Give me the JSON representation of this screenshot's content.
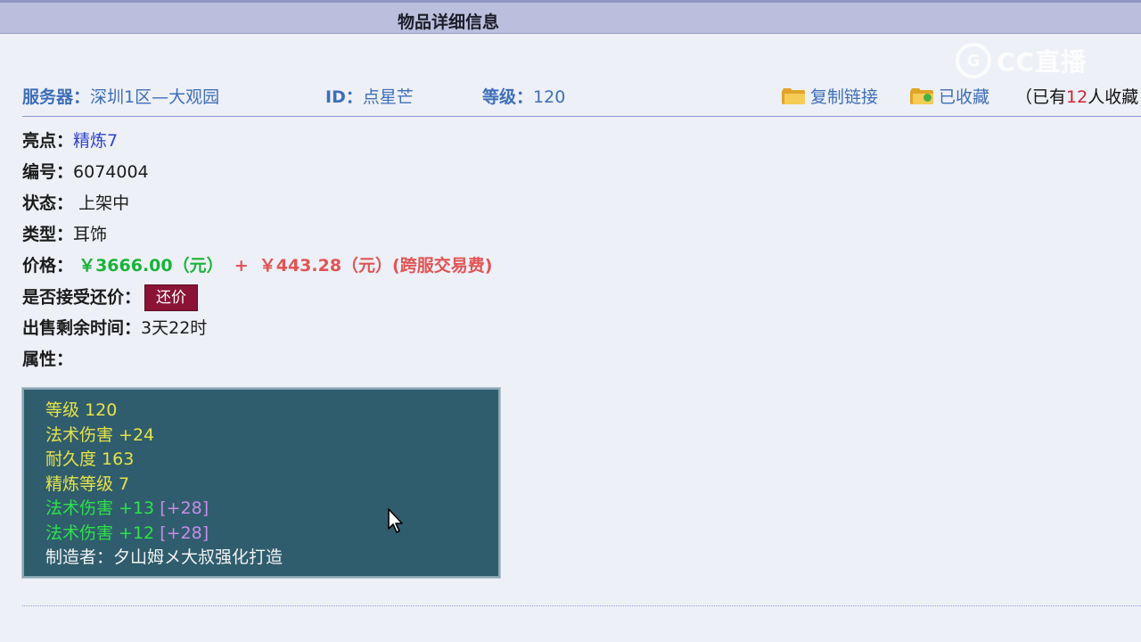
{
  "header": {
    "title": "物品详细信息"
  },
  "watermark": {
    "mark": "G",
    "text": "CC直播"
  },
  "info": {
    "server_label": "服务器：",
    "server_value": "深圳1区—大观园",
    "id_label": "ID：",
    "id_value": "点星芒",
    "level_label": "等级：",
    "level_value": "120",
    "copy_link": "复制链接",
    "favorited": "已收藏",
    "collect_prefix": "（已有",
    "collect_num": "12",
    "collect_suffix": "人收藏"
  },
  "fields": {
    "highlight_label": "亮点：",
    "highlight_value": "精炼7",
    "number_label": "编号：",
    "number_value": "6074004",
    "status_label": "状态：",
    "status_value": "上架中",
    "type_label": "类型：",
    "type_value": "耳饰",
    "price_label": "价格：",
    "price_main": "￥3666.00（元）",
    "price_plus": "+",
    "price_fee": "￥443.28（元）(跨服交易费)",
    "bargain_label": "是否接受还价：",
    "bargain_button": "还价",
    "remaining_label": "出售剩余时间：",
    "remaining_value": "3天22时",
    "attr_label": "属性："
  },
  "attributes": {
    "l1": "等级 120",
    "l2": "法术伤害 +24",
    "l3": "耐久度 163",
    "l4": "精炼等级 7",
    "l5_main": "法术伤害 +13",
    "l5_bonus": "[+28]",
    "l6_main": "法术伤害 +12",
    "l6_bonus": "[+28]",
    "l7": "制造者：夕山姆メ大叔强化打造"
  },
  "colors": {
    "accent_blue": "#3d6fb8",
    "price_green": "#18b43a",
    "price_red": "#e25454",
    "bargain_bg": "#8b1436",
    "attr_bg": "#2f5d6d"
  }
}
